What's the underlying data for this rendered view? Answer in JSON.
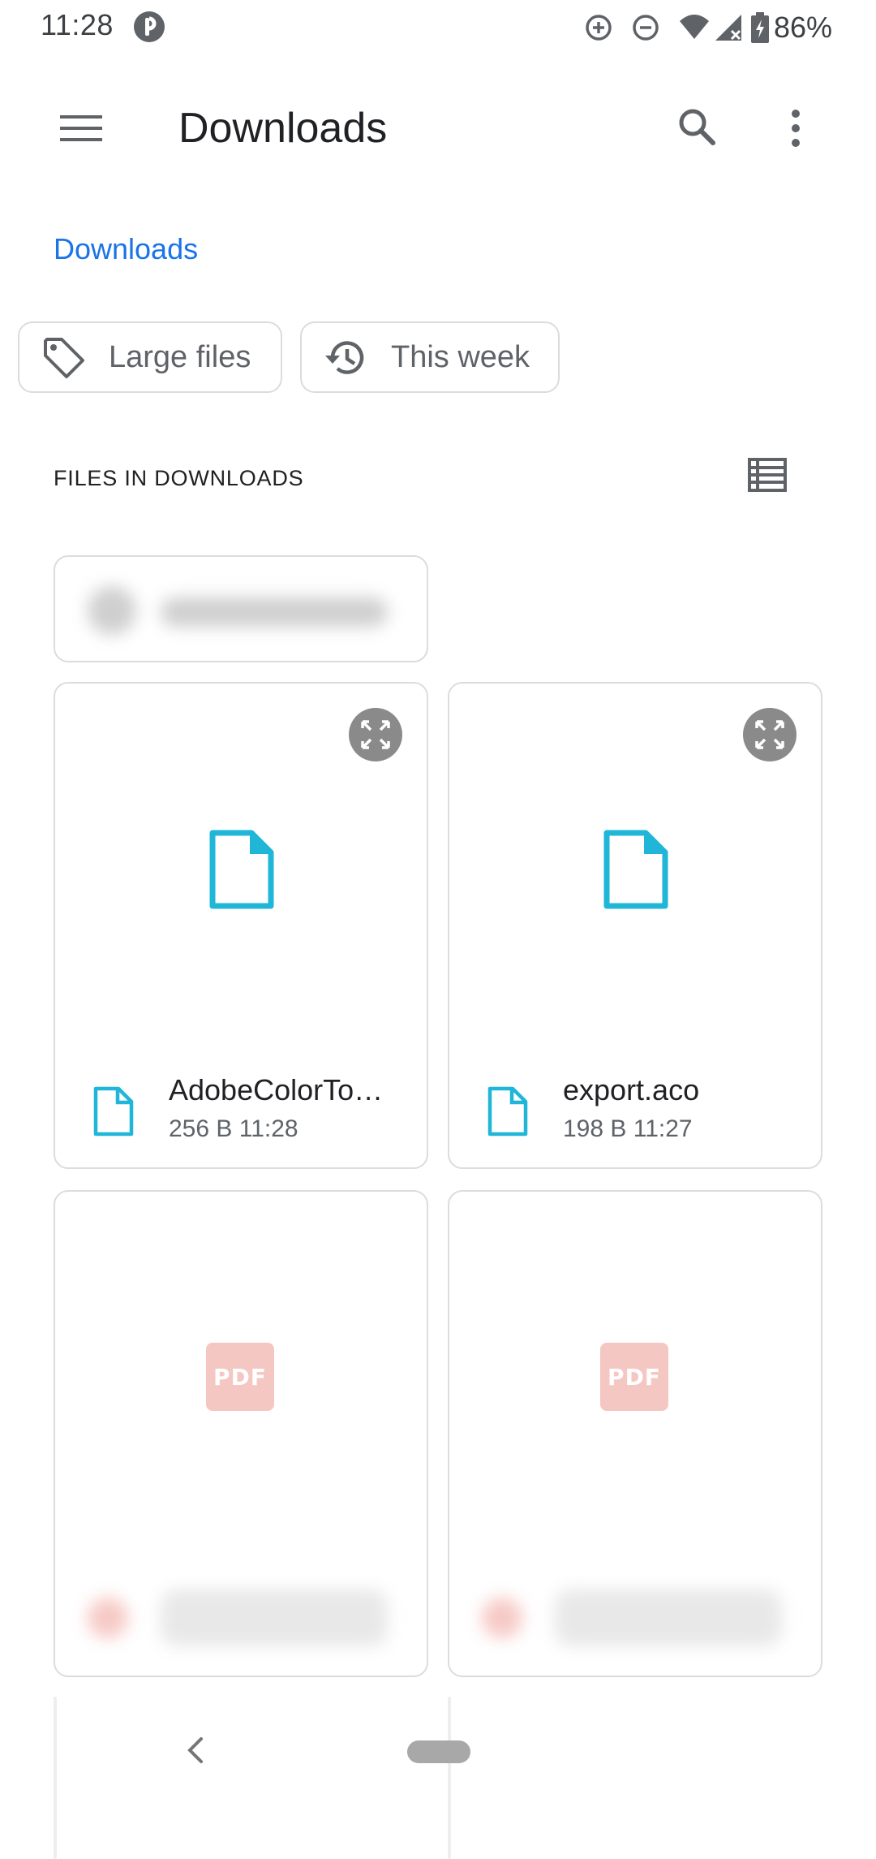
{
  "status_bar": {
    "time": "11:28",
    "battery": "86%"
  },
  "app_bar": {
    "title": "Downloads"
  },
  "breadcrumb": "Downloads",
  "chips": [
    {
      "label": "Large files",
      "icon": "label-tag-icon"
    },
    {
      "label": "This week",
      "icon": "history-icon"
    }
  ],
  "section": {
    "title": "FILES IN DOWNLOADS"
  },
  "files": [
    {
      "name": "AdobeColorTo…",
      "size": "256 B",
      "time": "11:28",
      "meta": "256 B  11:28",
      "type": "generic",
      "icon": "file-icon"
    },
    {
      "name": "export.aco",
      "size": "198 B",
      "time": "11:27",
      "meta": "198 B  11:27",
      "type": "generic",
      "icon": "file-icon"
    }
  ],
  "pdf_badge": "PDF",
  "colors": {
    "accent": "#1a73e8",
    "file_icon": "#1fb6d8",
    "pdf": "#f4c7c3",
    "border": "#dadce0"
  }
}
